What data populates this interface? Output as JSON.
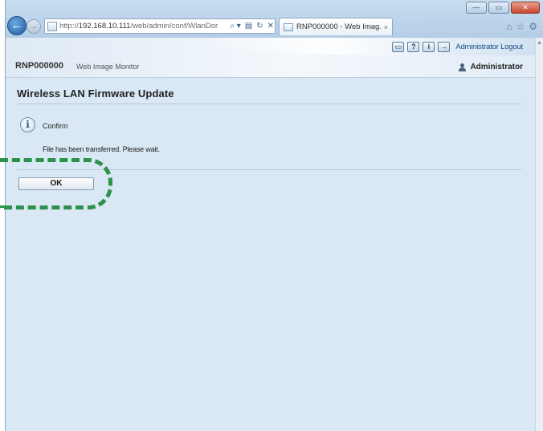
{
  "browser": {
    "window_controls": {
      "minimize": "—",
      "maximize": "▭",
      "close": "✕"
    },
    "back_glyph": "←",
    "forward_glyph": "→",
    "address_url_prefix": "http://",
    "address_url_host": "192.168.10.111",
    "address_url_path": "/web/admin/conf/WlanDor",
    "address_search_glyph": "⌕ ▾",
    "address_compat_glyph": "▤",
    "address_refresh_glyph": "↻",
    "address_stop_glyph": "✕",
    "tab_title": "RNP000000 - Web Imag...",
    "tab_close": "×",
    "toolbar_icons": {
      "home": "⌂",
      "favorites": "☆",
      "tools": "⚙"
    }
  },
  "header": {
    "device_name": "RNP000000",
    "app_name": "Web Image Monitor",
    "tool_icons": {
      "display": "▭",
      "help": "?",
      "info": "i",
      "logout": "→"
    },
    "logout_label": "Administrator Logout",
    "user_name": "Administrator"
  },
  "main": {
    "title": "Wireless LAN Firmware Update",
    "info_glyph": "i",
    "confirm_label": "Confirm",
    "message": "File has been transferred. Please wait.",
    "ok_label": "OK"
  },
  "colors": {
    "page_background": "#dae8f6",
    "highlight": "#2d9249",
    "link": "#1b4f86"
  }
}
